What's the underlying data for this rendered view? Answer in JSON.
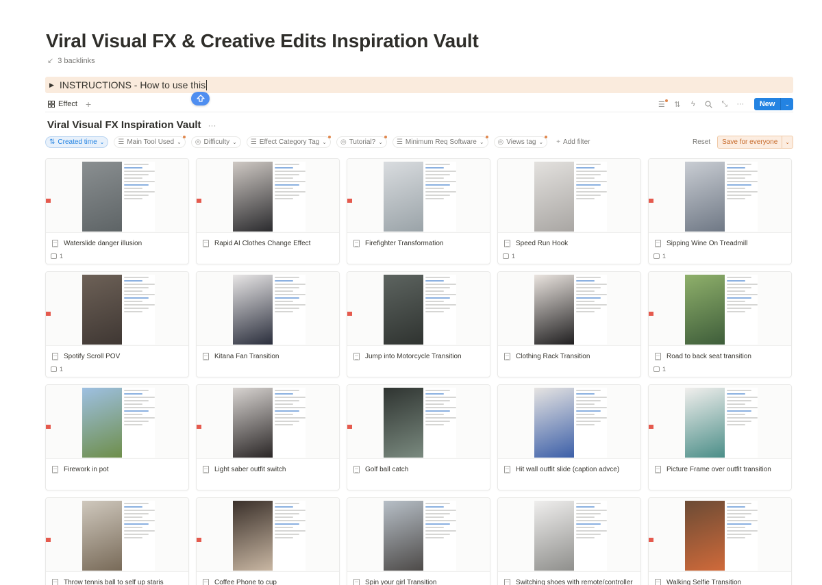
{
  "page": {
    "title": "Viral Visual FX & Creative Edits Inspiration Vault",
    "backlinks": "3 backlinks"
  },
  "toggle": {
    "label": "INSTRUCTIONS - How to use this"
  },
  "views": {
    "active_tab": "Effect",
    "new_label": "New"
  },
  "database": {
    "title": "Viral Visual FX Inspiration Vault"
  },
  "filters": {
    "sort_label": "Created time",
    "chips": [
      "Main Tool Used",
      "Difficulty",
      "Effect Category Tag",
      "Tutorial?",
      "Minimum Req Software",
      "Views tag"
    ],
    "add_filter": "Add filter",
    "reset": "Reset",
    "save": "Save for everyone"
  },
  "colors": {
    "accent": "#2383e2",
    "callout": "#faebdd",
    "save": "#c66a2a"
  },
  "cards": [
    {
      "title": "Waterslide danger illusion",
      "comments": "1"
    },
    {
      "title": "Rapid AI Clothes Change Effect",
      "comments": ""
    },
    {
      "title": "Firefighter Transformation",
      "comments": ""
    },
    {
      "title": "Speed Run Hook",
      "comments": "1"
    },
    {
      "title": "Sipping Wine On Treadmill",
      "comments": "1"
    },
    {
      "title": "Spotify Scroll POV",
      "comments": "1"
    },
    {
      "title": "Kitana Fan Transition",
      "comments": ""
    },
    {
      "title": "Jump into Motorcycle Transition",
      "comments": ""
    },
    {
      "title": "Clothing Rack Transition",
      "comments": ""
    },
    {
      "title": "Road to back seat transition",
      "comments": "1"
    },
    {
      "title": "Firework in pot",
      "comments": ""
    },
    {
      "title": "Light saber outfit switch",
      "comments": ""
    },
    {
      "title": "Golf ball catch",
      "comments": ""
    },
    {
      "title": "Hit wall outfit slide (caption advce)",
      "comments": ""
    },
    {
      "title": "Picture Frame over outfit transition",
      "comments": ""
    },
    {
      "title": "Throw tennis ball to self up staris",
      "comments": ""
    },
    {
      "title": "Coffee Phone to cup",
      "comments": ""
    },
    {
      "title": "Spin your girl Transition",
      "comments": ""
    },
    {
      "title": "Switching shoes with remote/controller",
      "comments": ""
    },
    {
      "title": "Walking Selfie Transition",
      "comments": ""
    }
  ]
}
